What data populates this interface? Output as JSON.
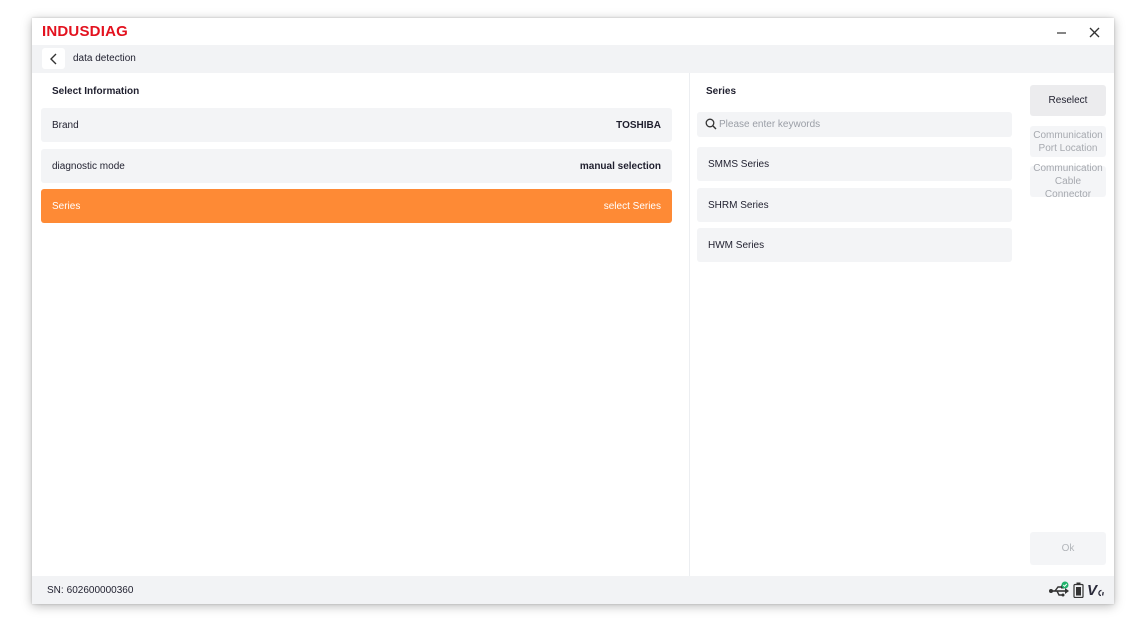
{
  "app": {
    "brand": "INDUSDIAG"
  },
  "nav": {
    "title": "data detection"
  },
  "select_info": {
    "title": "Select Information",
    "rows": [
      {
        "label": "Brand",
        "value": "TOSHIBA"
      },
      {
        "label": "diagnostic mode",
        "value": "manual selection"
      },
      {
        "label": "Series",
        "value": "select Series"
      }
    ]
  },
  "series": {
    "title": "Series",
    "search_placeholder": "Please enter keywords",
    "items": [
      "SMMS Series",
      "SHRM Series",
      "HWM Series"
    ]
  },
  "side": {
    "reselect": "Reselect",
    "port_location": "Communication Port Location",
    "cable_connector": "Communication Cable Connector",
    "ok": "Ok"
  },
  "status": {
    "sn_label": "SN:",
    "sn_value": "602600000360",
    "vci_label": "V"
  },
  "colors": {
    "brand": "#e3121f",
    "accent": "#fe8a35",
    "row_bg": "#f3f4f6",
    "connected": "#20b26b"
  }
}
